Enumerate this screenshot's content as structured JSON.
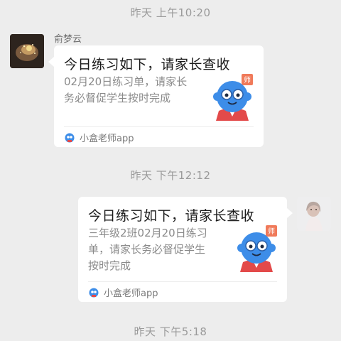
{
  "timestamps": [
    "昨天 上午10:20",
    "昨天 下午12:12",
    "昨天 下午5:18"
  ],
  "messages": [
    {
      "sender": "俞梦云",
      "card": {
        "title": "今日练习如下，请家长查收",
        "desc_lines": [
          "02月20日练习单，请家长",
          "务必督促学生按时完成"
        ],
        "badge": "师",
        "app": "小盒老师app"
      }
    },
    {
      "card": {
        "title": "今日练习如下，请家长查收",
        "desc_lines": [
          "三年级2班02月20日练习",
          "单，请家长务必督促学生",
          "按时完成"
        ],
        "badge": "师",
        "app": "小盒老师app"
      }
    }
  ],
  "colors": {
    "background": "#ededed",
    "card": "#ffffff",
    "mascot": "#3d8de8",
    "badge": "#f07a5a"
  }
}
